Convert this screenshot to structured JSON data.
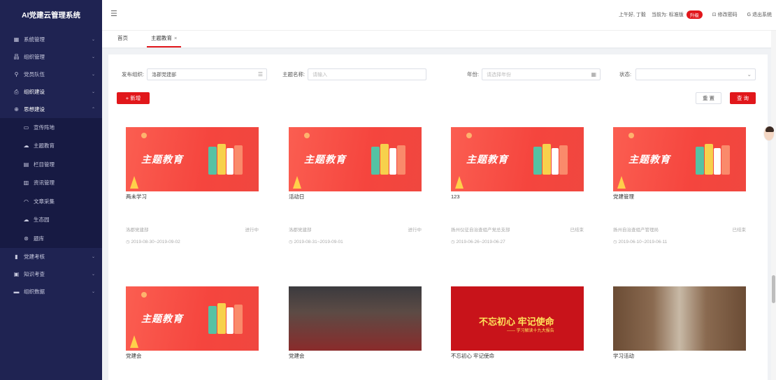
{
  "app": {
    "title": "AI党建云管理系统"
  },
  "sidebar": {
    "items": [
      {
        "label": "系统管理",
        "icon": "grid-icon",
        "glyph": "▦",
        "arrow": "⌄",
        "bold": false
      },
      {
        "label": "组织管理",
        "icon": "org-icon",
        "glyph": "品",
        "arrow": "⌄",
        "bold": false
      },
      {
        "label": "党员队伍",
        "icon": "user-icon",
        "glyph": "⚲",
        "arrow": "⌄",
        "bold": false
      },
      {
        "label": "组织建设",
        "icon": "building-icon",
        "glyph": "⎙",
        "arrow": "⌄",
        "bold": true
      },
      {
        "label": "思想建设",
        "icon": "globe-icon",
        "glyph": "⊕",
        "arrow": "⌃",
        "bold": true
      }
    ],
    "subitems": [
      {
        "label": "宣传阵地",
        "icon": "monitor-icon",
        "glyph": "▭"
      },
      {
        "label": "主题教育",
        "icon": "cloud-icon",
        "glyph": "☁"
      },
      {
        "label": "栏目管理",
        "icon": "column-icon",
        "glyph": "▤"
      },
      {
        "label": "资讯管理",
        "icon": "news-icon",
        "glyph": "▥"
      },
      {
        "label": "文章采集",
        "icon": "collect-icon",
        "glyph": "◠"
      },
      {
        "label": "生态园",
        "icon": "eco-icon",
        "glyph": "☁"
      },
      {
        "label": "题库",
        "icon": "library-icon",
        "glyph": "⊛"
      }
    ],
    "items2": [
      {
        "label": "党建考核",
        "icon": "chart-icon",
        "glyph": "▮",
        "arrow": "⌄"
      },
      {
        "label": "知识考查",
        "icon": "book-icon",
        "glyph": "▣",
        "arrow": "⌄"
      },
      {
        "label": "组织数据",
        "icon": "data-icon",
        "glyph": "▬",
        "arrow": "⌄"
      }
    ]
  },
  "header": {
    "greeting": "上午好, 丁毅",
    "version_label": "当前为: 标准版",
    "upgrade": "升级",
    "change_password": "修改密码",
    "logout": "退出系统"
  },
  "tabs": [
    {
      "label": "首页",
      "closable": false
    },
    {
      "label": "主题教育",
      "closable": true,
      "close": "×"
    }
  ],
  "filters": {
    "org_label": "发布组织:",
    "org_value": "洛郡党建部",
    "name_label": "主题名称:",
    "name_placeholder": "请输入",
    "year_label": "年份:",
    "year_placeholder": "请选择年份",
    "status_label": "状态:",
    "status_value": ""
  },
  "buttons": {
    "add": "+ 新增",
    "reset": "重 置",
    "search": "查 询"
  },
  "cards": [
    {
      "title": "两未学习",
      "org": "洛郡党建部",
      "status": "进行中",
      "date": "2019-08-30~2019-09-02",
      "thumb": "theme",
      "banner": "主题教育"
    },
    {
      "title": "活动日",
      "org": "洛郡党建部",
      "status": "进行中",
      "date": "2019-08-31~2019-09-01",
      "thumb": "theme",
      "banner": "主题教育"
    },
    {
      "title": "123",
      "org": "扬州仪征自治查组产党总支部",
      "status": "已结束",
      "date": "2019-06-26~2019-06-27",
      "thumb": "theme",
      "banner": "主题教育"
    },
    {
      "title": "党建管理",
      "org": "扬州自治查组产管理局",
      "status": "已结束",
      "date": "2019-06-10~2019-06-11",
      "thumb": "theme",
      "banner": "主题教育"
    },
    {
      "title": "党建会",
      "thumb": "theme",
      "banner": "主题教育"
    },
    {
      "title": "党建会",
      "thumb": "photo"
    },
    {
      "title": "不忘初心 牢记使命",
      "thumb": "red",
      "banner": "不忘初心 牢记使命",
      "banner_sub": "—— 学习解读十九大报告"
    },
    {
      "title": "学习活动",
      "thumb": "office"
    }
  ]
}
